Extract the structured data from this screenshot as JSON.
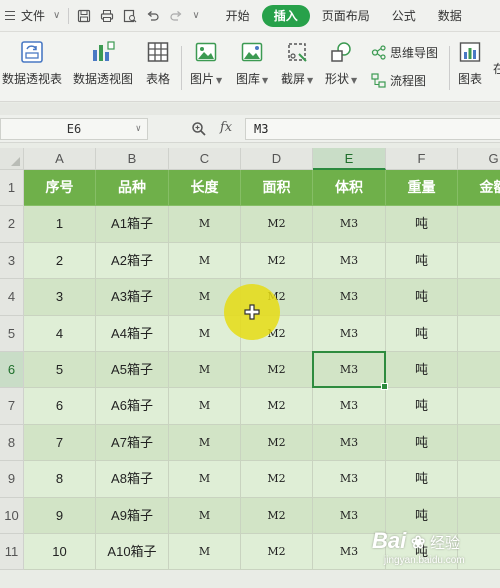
{
  "menubar": {
    "file_label": "文件",
    "tabs": [
      {
        "label": "开始",
        "active": false
      },
      {
        "label": "插入",
        "active": true
      },
      {
        "label": "页面布局",
        "active": false
      },
      {
        "label": "公式",
        "active": false
      },
      {
        "label": "数据",
        "active": false
      }
    ]
  },
  "ribbon": {
    "pivot_table": "数据透视表",
    "pivot_chart": "数据透视图",
    "table": "表格",
    "picture": "图片",
    "gallery": "图库",
    "screenshot": "截屏",
    "shapes": "形状",
    "mindmap": "思维导图",
    "flowchart": "流程图",
    "chart": "图表",
    "more": "在"
  },
  "formula_bar": {
    "cell_ref": "E6",
    "fx_label": "fx",
    "value": "M3"
  },
  "grid": {
    "columns": [
      "A",
      "B",
      "C",
      "D",
      "E",
      "F",
      "G"
    ],
    "rows": [
      "1",
      "2",
      "3",
      "4",
      "5",
      "6",
      "7",
      "8",
      "9",
      "10",
      "11"
    ],
    "selected_column": "E",
    "selected_row": "6",
    "selected_cell": "E6",
    "header": [
      "序号",
      "品种",
      "长度",
      "面积",
      "体积",
      "重量",
      "金额"
    ],
    "data": [
      [
        "1",
        "A1箱子",
        "M",
        "M2",
        "M3",
        "吨"
      ],
      [
        "2",
        "A2箱子",
        "M",
        "M2",
        "M3",
        "吨"
      ],
      [
        "3",
        "A3箱子",
        "M",
        "M2",
        "M3",
        "吨"
      ],
      [
        "4",
        "A4箱子",
        "M",
        "M2",
        "M3",
        "吨"
      ],
      [
        "5",
        "A5箱子",
        "M",
        "M2",
        "M3",
        "吨"
      ],
      [
        "6",
        "A6箱子",
        "M",
        "M2",
        "M3",
        "吨"
      ],
      [
        "7",
        "A7箱子",
        "M",
        "M2",
        "M3",
        "吨"
      ],
      [
        "8",
        "A8箱子",
        "M",
        "M2",
        "M3",
        "吨"
      ],
      [
        "9",
        "A9箱子",
        "M",
        "M2",
        "M3",
        "吨"
      ],
      [
        "10",
        "A10箱子",
        "M",
        "M2",
        "M3",
        "吨"
      ]
    ]
  },
  "watermark": {
    "brand": "Bai",
    "suffix": "经验",
    "url": "jingyan.baidu.com"
  },
  "colors": {
    "accent_green": "#27a14a",
    "header_fill": "#6fb04a",
    "body_fill": "#d2e4c6",
    "selection_border": "#2e8b3e",
    "cursor_halo": "#e6dc14"
  },
  "icons": [
    "menu-icon",
    "save-icon",
    "print-icon",
    "preview-icon",
    "undo-icon",
    "redo-icon",
    "pivot-table-icon",
    "pivot-chart-icon",
    "table-icon",
    "picture-icon",
    "gallery-icon",
    "screenshot-icon",
    "shapes-icon",
    "mindmap-icon",
    "flowchart-icon",
    "chart-icon",
    "zoom-icon",
    "cursor-icon"
  ]
}
